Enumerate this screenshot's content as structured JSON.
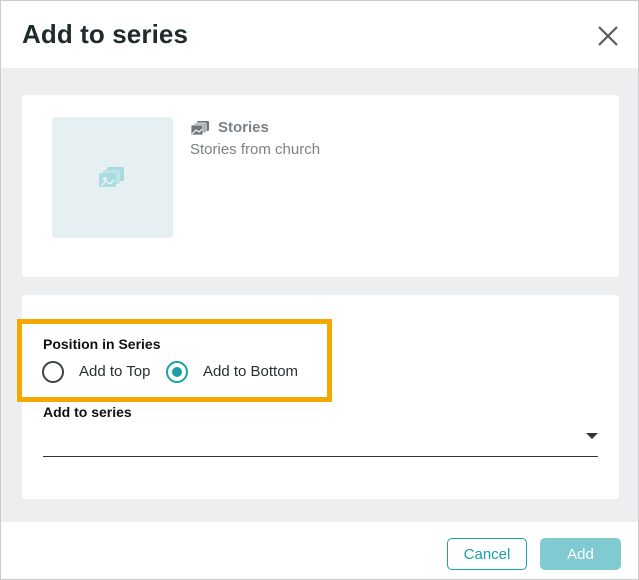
{
  "dialog": {
    "title": "Add to series",
    "close_icon": "close-icon"
  },
  "series_card": {
    "thumbnail_icon": "series-stack-icon",
    "name_icon": "series-stack-icon",
    "name": "Stories",
    "description": "Stories from church"
  },
  "position": {
    "label": "Position in Series",
    "options": [
      {
        "label": "Add to Top",
        "selected": false
      },
      {
        "label": "Add to Bottom",
        "selected": true
      }
    ]
  },
  "add_to_series": {
    "label": "Add to series",
    "value": ""
  },
  "buttons": {
    "cancel": "Cancel",
    "add": "Add"
  },
  "colors": {
    "accent": "#19a1a8",
    "highlight": "#f5a800",
    "add_disabled": "#7fcbd1"
  }
}
